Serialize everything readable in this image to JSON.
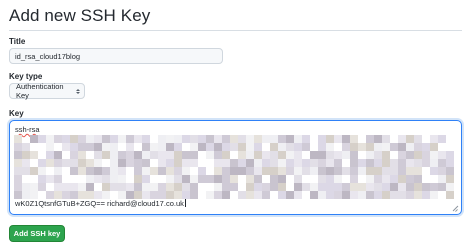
{
  "page": {
    "title": "Add new SSH Key"
  },
  "form": {
    "title_label": "Title",
    "title_value": "id_rsa_cloud17blog",
    "key_type_label": "Key type",
    "key_type_selected": "Authentication Key",
    "key_label": "Key",
    "key_prefix": "ssh-rsa",
    "key_suffix": "wK0Z1QtsnfGTuB+ZGQ== richard@cloud17.co.uk",
    "submit_label": "Add SSH key"
  },
  "colors": {
    "accent_focus": "#2f81f7",
    "button_green": "#2da44e",
    "spellcheck_underline": "#e5534b"
  },
  "icons": {
    "select_chevron": "chevron-updown-icon",
    "resize": "resize-grip-icon"
  }
}
